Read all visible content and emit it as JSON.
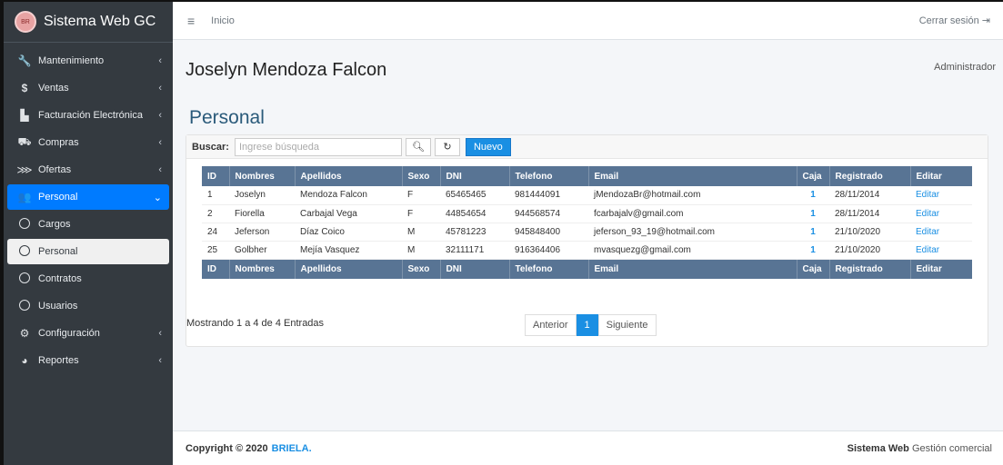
{
  "brand": {
    "title": "Sistema Web GC",
    "logo_text": "BR"
  },
  "sidebar": {
    "items": [
      {
        "label": "Mantenimiento",
        "icon": "wrench-icon"
      },
      {
        "label": "Ventas",
        "icon": "dollar-icon"
      },
      {
        "label": "Facturación Electrónica",
        "icon": "building-icon"
      },
      {
        "label": "Compras",
        "icon": "cart-icon"
      },
      {
        "label": "Ofertas",
        "icon": "tags-icon"
      },
      {
        "label": "Personal",
        "icon": "users-icon"
      },
      {
        "label": "Cargos"
      },
      {
        "label": "Personal"
      },
      {
        "label": "Contratos"
      },
      {
        "label": "Usuarios"
      },
      {
        "label": "Configuración",
        "icon": "gear-icon"
      },
      {
        "label": "Reportes",
        "icon": "pie-chart-icon"
      }
    ]
  },
  "topbar": {
    "breadcrumb": "Inicio",
    "logout": "Cerrar sesión"
  },
  "header": {
    "user": "Joselyn Mendoza Falcon",
    "role": "Administrador",
    "page_title": "Personal"
  },
  "toolbar": {
    "search_label": "Buscar:",
    "search_placeholder": "Ingrese búsqueda",
    "new_label": "Nuevo"
  },
  "table": {
    "headers": [
      "ID",
      "Nombres",
      "Apellidos",
      "Sexo",
      "DNI",
      "Telefono",
      "Email",
      "Caja",
      "Registrado",
      "Editar"
    ],
    "rows": [
      [
        "1",
        "Joselyn",
        "Mendoza Falcon",
        "F",
        "65465465",
        "981444091",
        "jMendozaBr@hotmail.com",
        "1",
        "28/11/2014",
        "Editar"
      ],
      [
        "2",
        "Fiorella",
        "Carbajal Vega",
        "F",
        "44854654",
        "944568574",
        "fcarbajalv@gmail.com",
        "1",
        "28/11/2014",
        "Editar"
      ],
      [
        "24",
        "Jeferson",
        "Díaz Coico",
        "M",
        "45781223",
        "945848400",
        "jeferson_93_19@hotmail.com",
        "1",
        "21/10/2020",
        "Editar"
      ],
      [
        "25",
        "Golbher",
        "Mejía Vasquez",
        "M",
        "32111171",
        "916364406",
        "mvasquezg@gmail.com",
        "1",
        "21/10/2020",
        "Editar"
      ]
    ]
  },
  "pagination": {
    "info": "Mostrando 1 a 4 de 4 Entradas",
    "prev": "Anterior",
    "current": "1",
    "next": "Siguiente"
  },
  "footer": {
    "copyright": "Copyright © 2020",
    "company": "BRIELA.",
    "app_bold": "Sistema Web",
    "app_rest": " Gestión comercial"
  },
  "colors": {
    "sidebar": "#343a40",
    "accent": "#007bff",
    "table_header": "#587494"
  }
}
